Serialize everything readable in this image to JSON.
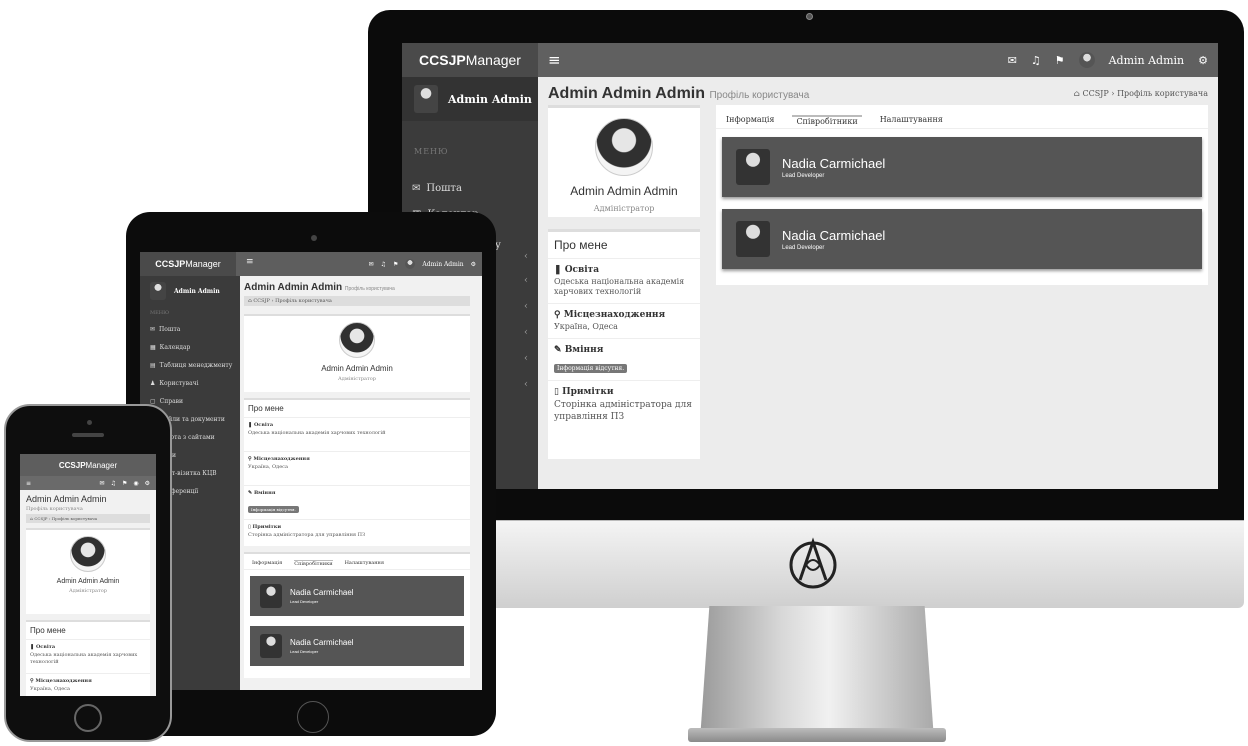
{
  "app": {
    "brand_a": "CCSJP",
    "brand_b": "Manager",
    "hamburger": "≡",
    "user": "Admin Admin"
  },
  "sidebar": {
    "user": "Admin Admin",
    "menu_header": "МЕНЮ",
    "items": [
      {
        "label": "Пошта"
      },
      {
        "label": "Календар"
      },
      {
        "label": "Таблиця менеджменту"
      },
      {
        "label": "Користувачі"
      },
      {
        "label": "Справи"
      },
      {
        "label": "Файли та документи"
      },
      {
        "label": "Робота з сайтами"
      },
      {
        "label": "Звіти"
      },
      {
        "label": "Сайт-візитка КЦВ"
      },
      {
        "label": "Конференції"
      }
    ]
  },
  "page": {
    "title": "Admin Admin Admin",
    "subtitle": "Профіль користувача",
    "breadcrumb_home": "CCSJP",
    "breadcrumb_current": "Профіль користувача"
  },
  "profile": {
    "name": "Admin Admin Admin",
    "role": "Адміністратор"
  },
  "about": {
    "title": "Про мене",
    "education_h": "Освіта",
    "education_t": "Одеська національна академія харчових технологій",
    "location_h": "Місцезнаходження",
    "location_t": "Україна, Одеса",
    "skills_h": "Вміння",
    "skills_badge": "Інформація відсутня.",
    "notes_h": "Примітки",
    "notes_t": "Сторінка адміністратора для управління ПЗ"
  },
  "tabs": [
    {
      "label": "Інформація"
    },
    {
      "label": "Співробітники"
    },
    {
      "label": "Налаштування"
    }
  ],
  "employees": [
    {
      "name": "Nadia Carmichael",
      "role": "Lead Developer"
    },
    {
      "name": "Nadia Carmichael",
      "role": "Lead Developer"
    }
  ],
  "colors": {
    "topbar": "#606060",
    "sidebar": "#3b3b3b",
    "employee_card": "#555555"
  }
}
